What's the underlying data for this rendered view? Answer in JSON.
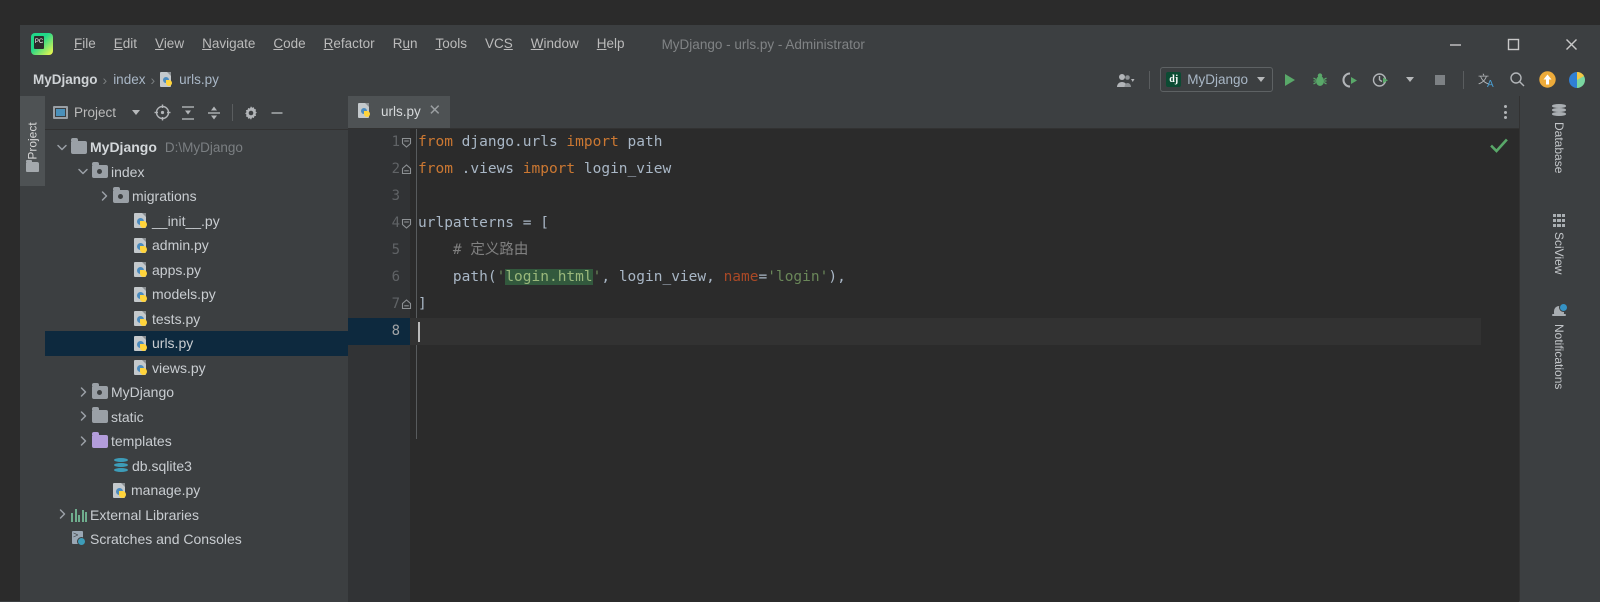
{
  "window": {
    "title": "MyDjango - urls.py - Administrator",
    "app_icon": "pycharm-logo-icon",
    "controls": {
      "minimize": "minimize-icon",
      "maximize": "maximize-icon",
      "close": "close-icon"
    }
  },
  "menu": {
    "items": [
      {
        "label": "File",
        "mnemonic": "F",
        "rest": "ile"
      },
      {
        "label": "Edit",
        "mnemonic": "E",
        "rest": "dit"
      },
      {
        "label": "View",
        "mnemonic": "V",
        "rest": "iew"
      },
      {
        "label": "Navigate",
        "mnemonic": "N",
        "rest": "avigate"
      },
      {
        "label": "Code",
        "mnemonic": "C",
        "rest": "ode"
      },
      {
        "label": "Refactor",
        "mnemonic": "R",
        "rest": "efactor"
      },
      {
        "label": "Run",
        "mnemonic": "R",
        "rest": "un"
      },
      {
        "label": "Tools",
        "mnemonic": "T",
        "rest": "ools"
      },
      {
        "label": "VCS",
        "mnemonic": "S",
        "rest": "VCS"
      },
      {
        "label": "Window",
        "mnemonic": "W",
        "rest": "indow"
      },
      {
        "label": "Help",
        "mnemonic": "H",
        "rest": "elp"
      }
    ]
  },
  "breadcrumb": {
    "items": [
      "MyDjango",
      "index",
      "urls.py"
    ],
    "separator": "›",
    "file_icon": "python-file-icon"
  },
  "toolbar": {
    "account_icon": "user-account-icon",
    "run_config": {
      "icon": "django-icon",
      "icon_label": "dj",
      "label": "MyDjango"
    },
    "run_icon": "run-play-icon",
    "debug_icon": "debug-bug-icon",
    "run_coverage_icon": "run-with-coverage-icon",
    "profile_icon": "profiler-icon",
    "stop_icon": "stop-icon",
    "translate_icon": "translate-icon",
    "search_icon": "search-everywhere-icon",
    "update_icon": "update-project-icon",
    "plugin_icon": "plugin-icon"
  },
  "left_strip": {
    "tool_window": "Project",
    "folder_icon": "folder-icon"
  },
  "project_panel": {
    "title": "Project",
    "title_icon": "project-view-icon",
    "dropdown_icon": "chevron-down-icon",
    "buttons": [
      {
        "name": "scroll-from-source-icon",
        "label": "Select Opened File"
      },
      {
        "name": "expand-all-icon",
        "label": "Expand All"
      },
      {
        "name": "collapse-all-icon",
        "label": "Collapse All"
      },
      {
        "name": "settings-gear-icon",
        "label": "Settings"
      },
      {
        "name": "hide-panel-icon",
        "label": "Hide"
      }
    ],
    "tree": [
      {
        "label": "MyDjango",
        "sub": "D:\\MyDjango",
        "icon": "folder-icon",
        "indent": 0,
        "arrow": "down",
        "bold": true,
        "selected": false
      },
      {
        "label": "index",
        "sub": "",
        "icon": "module-folder-icon",
        "indent": 1,
        "arrow": "down",
        "bold": false,
        "selected": false
      },
      {
        "label": "migrations",
        "sub": "",
        "icon": "module-folder-icon",
        "indent": 2,
        "arrow": "right",
        "bold": false,
        "selected": false
      },
      {
        "label": "__init__.py",
        "sub": "",
        "icon": "python-file-icon",
        "indent": 3,
        "arrow": "none",
        "bold": false,
        "selected": false
      },
      {
        "label": "admin.py",
        "sub": "",
        "icon": "python-file-icon",
        "indent": 3,
        "arrow": "none",
        "bold": false,
        "selected": false
      },
      {
        "label": "apps.py",
        "sub": "",
        "icon": "python-file-icon",
        "indent": 3,
        "arrow": "none",
        "bold": false,
        "selected": false
      },
      {
        "label": "models.py",
        "sub": "",
        "icon": "python-file-icon",
        "indent": 3,
        "arrow": "none",
        "bold": false,
        "selected": false
      },
      {
        "label": "tests.py",
        "sub": "",
        "icon": "python-file-icon",
        "indent": 3,
        "arrow": "none",
        "bold": false,
        "selected": false
      },
      {
        "label": "urls.py",
        "sub": "",
        "icon": "python-file-icon",
        "indent": 3,
        "arrow": "none",
        "bold": false,
        "selected": true
      },
      {
        "label": "views.py",
        "sub": "",
        "icon": "python-file-icon",
        "indent": 3,
        "arrow": "none",
        "bold": false,
        "selected": false
      },
      {
        "label": "MyDjango",
        "sub": "",
        "icon": "module-folder-icon",
        "indent": 1,
        "arrow": "right",
        "bold": false,
        "selected": false
      },
      {
        "label": "static",
        "sub": "",
        "icon": "folder-icon",
        "indent": 1,
        "arrow": "right",
        "bold": false,
        "selected": false
      },
      {
        "label": "templates",
        "sub": "",
        "icon": "templates-folder-icon",
        "indent": 1,
        "arrow": "right",
        "bold": false,
        "selected": false
      },
      {
        "label": "db.sqlite3",
        "sub": "",
        "icon": "database-file-icon",
        "indent": 2,
        "arrow": "none",
        "bold": false,
        "selected": false
      },
      {
        "label": "manage.py",
        "sub": "",
        "icon": "python-file-icon",
        "indent": 2,
        "arrow": "none",
        "bold": false,
        "selected": false
      },
      {
        "label": "External Libraries",
        "sub": "",
        "icon": "libraries-icon",
        "indent": 0,
        "arrow": "right",
        "bold": false,
        "selected": false
      },
      {
        "label": "Scratches and Consoles",
        "sub": "",
        "icon": "scratches-icon",
        "indent": 0,
        "arrow": "none",
        "bold": false,
        "selected": false
      }
    ]
  },
  "editor": {
    "tab": {
      "label": "urls.py",
      "icon": "python-file-icon",
      "close_icon": "close-icon"
    },
    "options_icon": "more-options-icon",
    "inspection_status_icon": "inspection-ok-check-icon",
    "current_line": 8,
    "line_numbers": [
      1,
      2,
      3,
      4,
      5,
      6,
      7,
      8
    ],
    "lines": [
      {
        "n": 1,
        "fold": "start",
        "tokens": [
          {
            "t": "from",
            "c": "kw"
          },
          {
            "t": " django.urls ",
            "c": "pln"
          },
          {
            "t": "import",
            "c": "kw"
          },
          {
            "t": " path",
            "c": "pln"
          }
        ]
      },
      {
        "n": 2,
        "fold": "end",
        "tokens": [
          {
            "t": "from",
            "c": "kw"
          },
          {
            "t": " .views ",
            "c": "pln"
          },
          {
            "t": "import",
            "c": "kw"
          },
          {
            "t": " login_view",
            "c": "pln"
          }
        ]
      },
      {
        "n": 3,
        "fold": "none",
        "tokens": []
      },
      {
        "n": 4,
        "fold": "start",
        "tokens": [
          {
            "t": "urlpatterns = [",
            "c": "pln"
          }
        ]
      },
      {
        "n": 5,
        "fold": "none",
        "tokens": [
          {
            "t": "    # 定义路由",
            "c": "cmt"
          }
        ]
      },
      {
        "n": 6,
        "fold": "none",
        "tokens": [
          {
            "t": "    path(",
            "c": "pln"
          },
          {
            "t": "'",
            "c": "str"
          },
          {
            "t": "login.html",
            "c": "hl-str"
          },
          {
            "t": "'",
            "c": "str"
          },
          {
            "t": ", login_view, ",
            "c": "pln"
          },
          {
            "t": "name",
            "c": "nm"
          },
          {
            "t": "=",
            "c": "pln"
          },
          {
            "t": "'login'",
            "c": "str"
          },
          {
            "t": "),",
            "c": "pln"
          }
        ]
      },
      {
        "n": 7,
        "fold": "end",
        "tokens": [
          {
            "t": "]",
            "c": "pln"
          }
        ]
      },
      {
        "n": 8,
        "fold": "none",
        "tokens": []
      }
    ]
  },
  "right_strip": {
    "tabs": [
      {
        "label": "Database",
        "icon": "database-icon"
      },
      {
        "label": "SciView",
        "icon": "sciview-grid-icon"
      },
      {
        "label": "Notifications",
        "icon": "notifications-bell-icon"
      }
    ]
  },
  "colors": {
    "background": "#3c3f41",
    "editor_background": "#2b2b2b",
    "selection": "#0d293e",
    "keyword": "#cc7832",
    "string": "#6a8759",
    "comment": "#808080",
    "named_arg": "#aa4926",
    "accent_green": "#59a869",
    "highlight_search": "#32593d"
  }
}
